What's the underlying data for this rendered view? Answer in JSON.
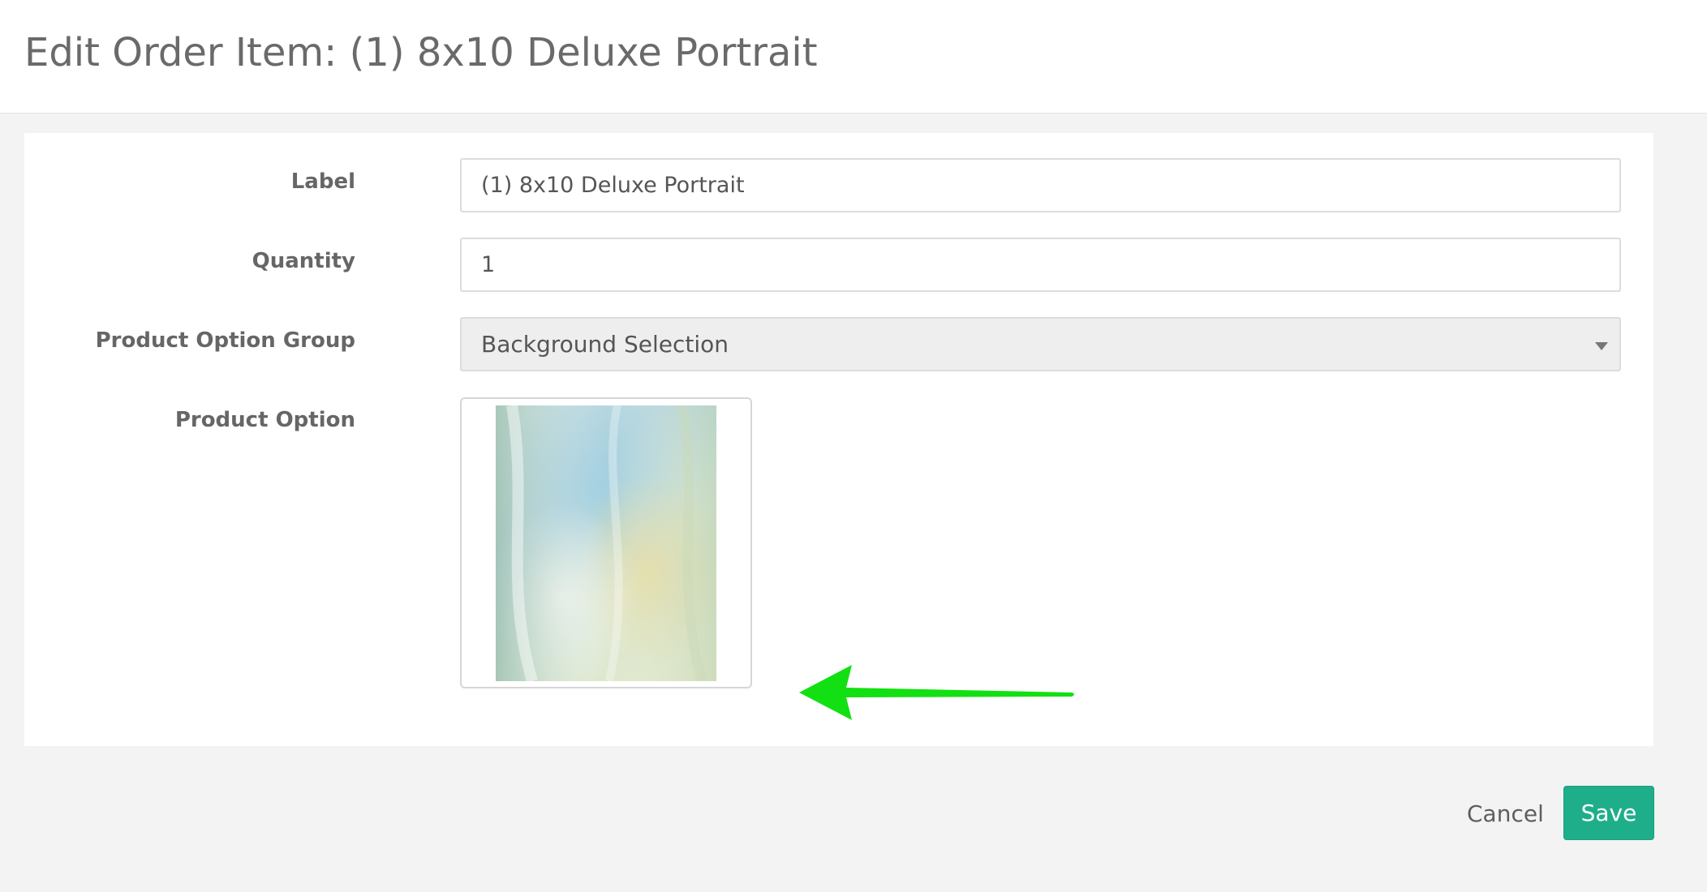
{
  "header": {
    "title": "Edit Order Item: (1) 8x10 Deluxe Portrait"
  },
  "form": {
    "label": {
      "label": "Label",
      "value": "(1) 8x10 Deluxe Portrait"
    },
    "quantity": {
      "label": "Quantity",
      "value": "1"
    },
    "product_option_group": {
      "label": "Product Option Group",
      "selected": "Background Selection"
    },
    "product_option": {
      "label": "Product Option",
      "image": "background-swatch"
    }
  },
  "annotation": {
    "arrow_color": "#12e012"
  },
  "footer": {
    "cancel_label": "Cancel",
    "save_label": "Save"
  },
  "colors": {
    "accent": "#1fae8a",
    "page_bg": "#f3f3f3"
  }
}
